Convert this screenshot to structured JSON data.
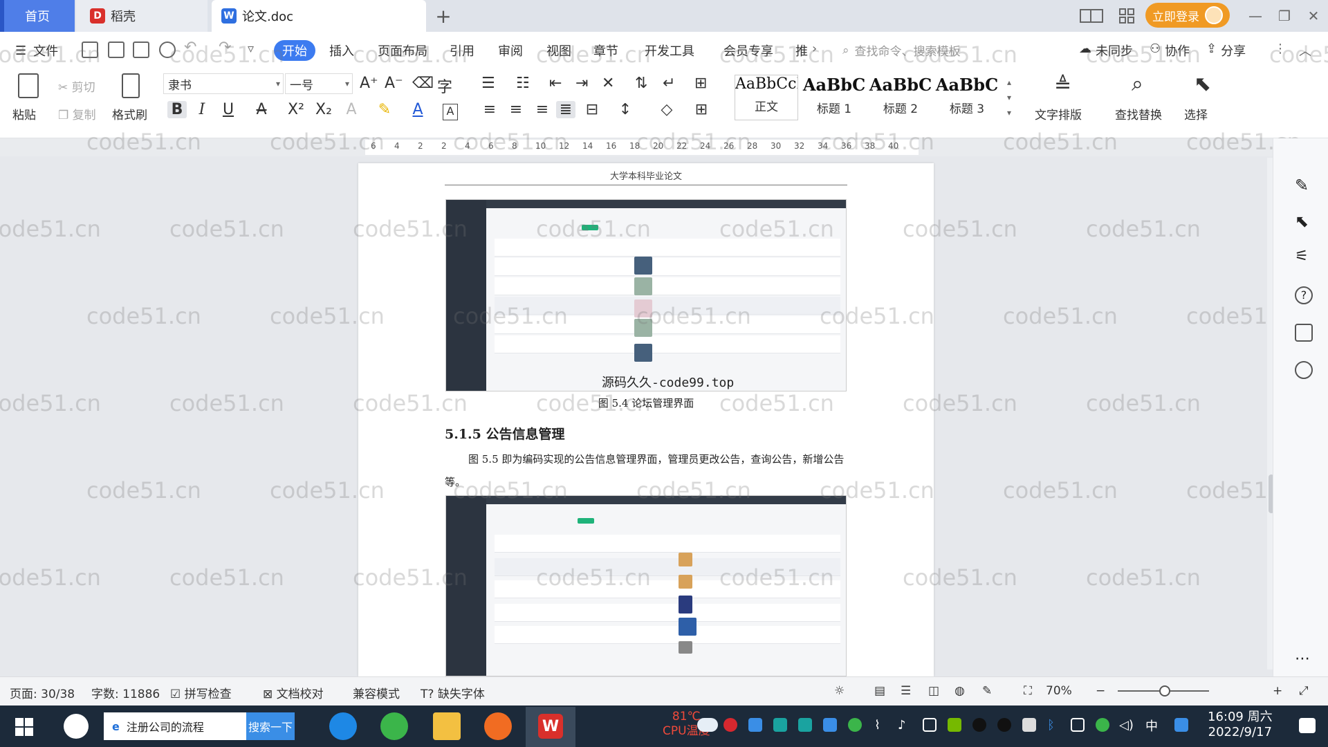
{
  "tabs": {
    "home": "首页",
    "daoke": "稻壳",
    "doc": "论文.doc"
  },
  "header_right": {
    "login": "立即登录"
  },
  "menu": {
    "file": "文件",
    "items": [
      "开始",
      "插入",
      "页面布局",
      "引用",
      "审阅",
      "视图",
      "章节",
      "开发工具",
      "会员专享",
      "推"
    ],
    "search_cmd": "查找命令、搜索模板",
    "sync": "未同步",
    "collab": "协作",
    "share": "分享"
  },
  "ribbon": {
    "paste": "粘贴",
    "cut": "剪切",
    "copy": "复制",
    "format_painter": "格式刷",
    "font_name": "隶书",
    "font_size": "一号",
    "styles": [
      {
        "preview": "AaBbCcI",
        "name": "正文"
      },
      {
        "preview": "AaBbC",
        "name": "标题 1"
      },
      {
        "preview": "AaBbC",
        "name": "标题 2"
      },
      {
        "preview": "AaBbC",
        "name": "标题 3"
      }
    ],
    "text_layout": "文字排版",
    "find_replace": "查找替换",
    "select": "选择"
  },
  "ruler_ticks": [
    "6",
    "4",
    "2",
    "2",
    "4",
    "6",
    "8",
    "10",
    "12",
    "14",
    "16",
    "18",
    "20",
    "22",
    "24",
    "26",
    "28",
    "30",
    "32",
    "34",
    "36",
    "38",
    "40"
  ],
  "document": {
    "page_header": "大学本科毕业论文",
    "overlay_text": "源码久久-code99.top",
    "caption_54": "图 5.4 论坛管理界面",
    "heading_515": "5.1.5  公告信息管理",
    "paragraph": "图 5.5 即为编码实现的公告信息管理界面，管理员更改公告，查询公告，新增公告等。"
  },
  "watermark": "code51.cn",
  "status": {
    "page": "页面: 30/38",
    "words": "字数: 11886",
    "spell": "拼写检查",
    "proof": "文档校对",
    "compat": "兼容模式",
    "missing_font": "缺失字体",
    "zoom": "70%"
  },
  "taskbar": {
    "search_text": "注册公司的流程",
    "search_btn": "搜索一下",
    "cpu_temp": "81℃",
    "cpu_label": "CPU温度",
    "ime": "中",
    "time": "16:09 周六",
    "date": "2022/9/17"
  },
  "colors": {
    "accent": "#3c7bf0",
    "login": "#f09a24",
    "taskbar": "#1c2a3a"
  }
}
